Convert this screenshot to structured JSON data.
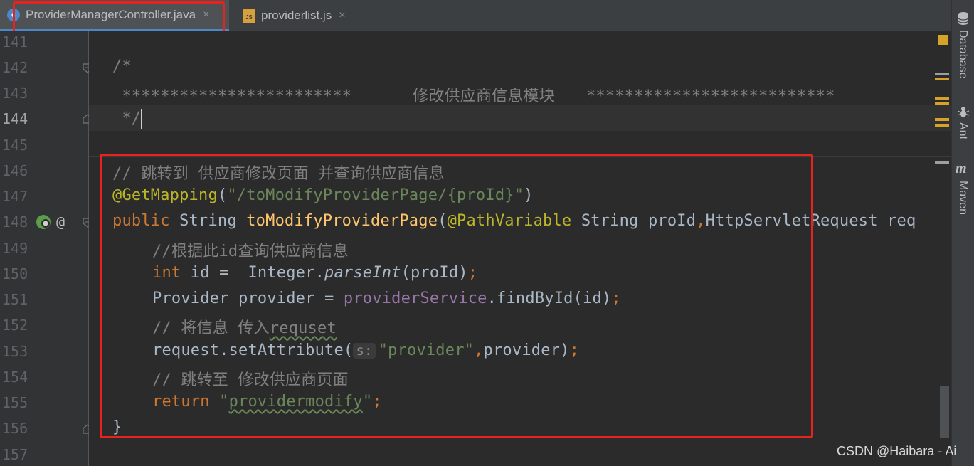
{
  "tabs": [
    {
      "label": "ProviderManagerController.java",
      "icon": "java-class-icon",
      "close": "×"
    },
    {
      "label": "providerlist.js",
      "icon": "js-file-icon",
      "close": "×"
    }
  ],
  "line_numbers": [
    "141",
    "142",
    "143",
    "144",
    "145",
    "146",
    "147",
    "148",
    "149",
    "150",
    "151",
    "152",
    "153",
    "154",
    "155",
    "156",
    "157"
  ],
  "code": {
    "l142": "/*",
    "l143_stars": " ************************",
    "l143_title": "修改供应商信息模块",
    "l143_stars_end": "**************************",
    "l144": " */",
    "l146": "// 跳转到 供应商修改页面 并查询供应商信息",
    "l147_annotation": "@GetMapping",
    "l147_paren_open": "(",
    "l147_string": "\"/toModifyProviderPage/{proId}\"",
    "l147_paren_close": ")",
    "l148_public": "public",
    "l148_type": " String ",
    "l148_method": "toModifyProviderPage",
    "l148_paren": "(",
    "l148_annotation": "@PathVariable",
    "l148_param1": " String proId",
    "l148_comma": ",",
    "l148_param2": "HttpServletRequest req",
    "l149": "//根据此id查询供应商信息",
    "l150_kw": "int",
    "l150_rest": " id =  Integer.",
    "l150_method": "parseInt",
    "l150_args": "(proId)",
    "l150_semi": ";",
    "l151_start": "Provider provider = ",
    "l151_field": "providerService",
    "l151_rest": ".findById(id)",
    "l151_semi": ";",
    "l152_prefix": "// 将信息 传入",
    "l152_typo": "requset",
    "l153_start": "request.setAttribute(",
    "l153_hint": "s:",
    "l153_string": "\"provider\"",
    "l153_comma": ",",
    "l153_rest": "provider)",
    "l153_semi": ";",
    "l154": "// 跳转至 修改供应商页面",
    "l155_kw": "return",
    "l155_quote_open": "\"",
    "l155_string": "providermodify",
    "l155_quote_close": "\"",
    "l155_semi": ";",
    "l156": "}"
  },
  "gutter_icons": {
    "run": "spring-mapping-icon",
    "at": "@"
  },
  "right_panel": {
    "database": "Database",
    "ant": "Ant",
    "maven": "Maven"
  },
  "watermark": "CSDN @Haibara - Ai",
  "colors": {
    "background": "#2b2b2b",
    "keyword": "#cc7832",
    "annotation": "#bbb529",
    "string": "#6a8759",
    "comment": "#808080",
    "method": "#ffc66d",
    "field": "#9876aa",
    "highlight_box": "#e8231f"
  }
}
